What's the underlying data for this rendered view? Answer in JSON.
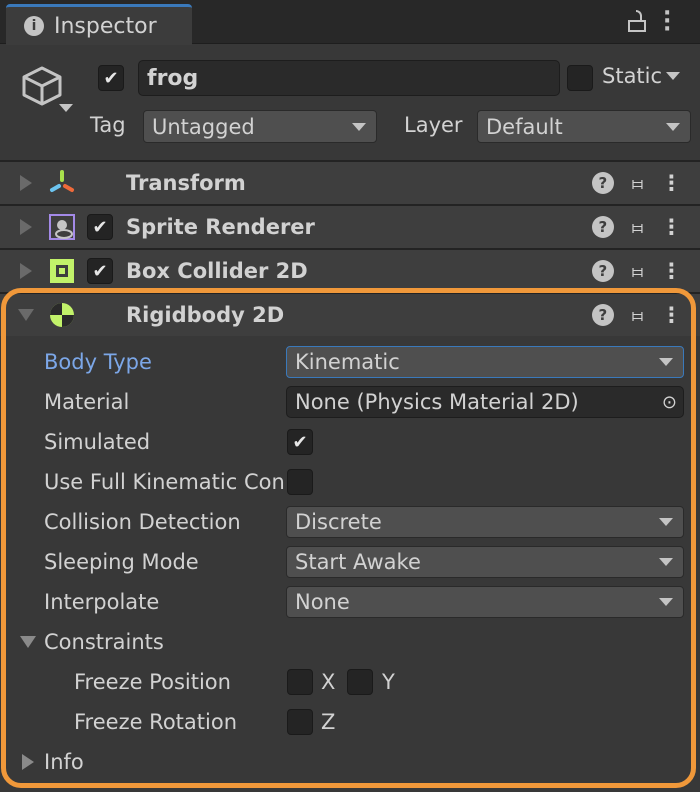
{
  "tab": {
    "title": "Inspector",
    "icon": "info-icon"
  },
  "header": {
    "active": true,
    "name": "frog",
    "static_label": "Static",
    "static": false,
    "tag_label": "Tag",
    "tag_value": "Untagged",
    "layer_label": "Layer",
    "layer_value": "Default"
  },
  "components": [
    {
      "name": "Transform",
      "expanded": false,
      "has_toggle": false,
      "icon": "transform-icon"
    },
    {
      "name": "Sprite Renderer",
      "expanded": false,
      "has_toggle": true,
      "enabled": true,
      "icon": "sprite-renderer-icon"
    },
    {
      "name": "Box Collider 2D",
      "expanded": false,
      "has_toggle": true,
      "enabled": true,
      "icon": "box-collider-icon"
    },
    {
      "name": "Rigidbody 2D",
      "expanded": true,
      "has_toggle": false,
      "icon": "rigidbody-icon"
    }
  ],
  "rigidbody": {
    "body_type": {
      "label": "Body Type",
      "value": "Kinematic"
    },
    "material": {
      "label": "Material",
      "value": "None (Physics Material 2D)"
    },
    "simulated": {
      "label": "Simulated",
      "checked": true
    },
    "full_kinematic": {
      "label": "Use Full Kinematic Contacts",
      "checked": false
    },
    "collision": {
      "label": "Collision Detection",
      "value": "Discrete"
    },
    "sleeping": {
      "label": "Sleeping Mode",
      "value": "Start Awake"
    },
    "interpolate": {
      "label": "Interpolate",
      "value": "None"
    },
    "constraints": {
      "label": "Constraints",
      "freeze_position": {
        "label": "Freeze Position",
        "x": "X",
        "y": "Y"
      },
      "freeze_rotation": {
        "label": "Freeze Rotation",
        "z": "Z"
      }
    },
    "info": {
      "label": "Info"
    }
  },
  "colors": {
    "highlight": "#f0983a",
    "accent_label": "#7ca7e8",
    "tab_accent": "#3a79bb"
  }
}
